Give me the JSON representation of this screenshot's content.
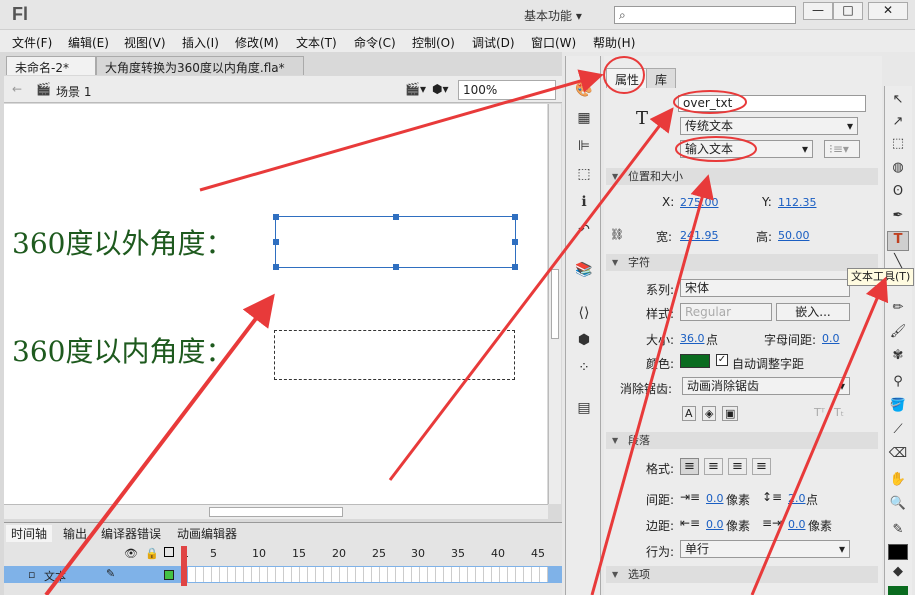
{
  "app": {
    "logo": "Fl",
    "workspace": "基本功能",
    "window_buttons": [
      "—",
      "□",
      "✕"
    ]
  },
  "menu": [
    "文件(F)",
    "编辑(E)",
    "视图(V)",
    "插入(I)",
    "修改(M)",
    "文本(T)",
    "命令(C)",
    "控制(O)",
    "调试(D)",
    "窗口(W)",
    "帮助(H)"
  ],
  "doc_tabs": [
    "未命名-2*",
    "大角度转换为360度以内角度.fla*"
  ],
  "editbar": {
    "scene": "场景 1",
    "zoom": "100%"
  },
  "stage": {
    "label1": "360度以外角度：",
    "label2": "360度以内角度："
  },
  "timeline": {
    "tabs": [
      "时间轴",
      "输出",
      "编译器错误",
      "动画编辑器"
    ],
    "numbers": [
      "1",
      "5",
      "10",
      "15",
      "20",
      "25",
      "30",
      "35",
      "40",
      "45"
    ],
    "layer": "文本"
  },
  "properties": {
    "tabs": [
      "属性",
      "库"
    ],
    "instance_name": "over_txt",
    "text_engine": "传统文本",
    "text_type": "输入文本",
    "sections": {
      "pos": "位置和大小",
      "char": "字符",
      "para": "段落",
      "options": "选项"
    },
    "x_label": "X:",
    "x": "275.00",
    "y_label": "Y:",
    "y": "112.35",
    "w_label": "宽:",
    "w": "241.95",
    "h_label": "高:",
    "h": "50.00",
    "family_label": "系列:",
    "family": "宋体",
    "style_label": "样式:",
    "style": "Regular",
    "embed": "嵌入...",
    "size_label": "大小:",
    "size": "36.0",
    "size_unit": "点",
    "spacing_label": "字母间距:",
    "spacing": "0.0",
    "color_label": "颜色:",
    "color": "#0a6b1f",
    "autokern": "自动调整字距",
    "aa_label": "消除锯齿:",
    "aa": "动画消除锯齿",
    "format_label": "格式:",
    "line_label": "间距:",
    "line1": "0.0",
    "line1_unit": "像素",
    "line2": "2.0",
    "line2_unit": "点",
    "margin_label": "边距:",
    "margin1": "0.0",
    "margin1_unit": "像素",
    "margin2": "0.0",
    "margin2_unit": "像素",
    "behavior_label": "行为:",
    "behavior": "单行"
  },
  "tooltip": "文本工具(T)"
}
